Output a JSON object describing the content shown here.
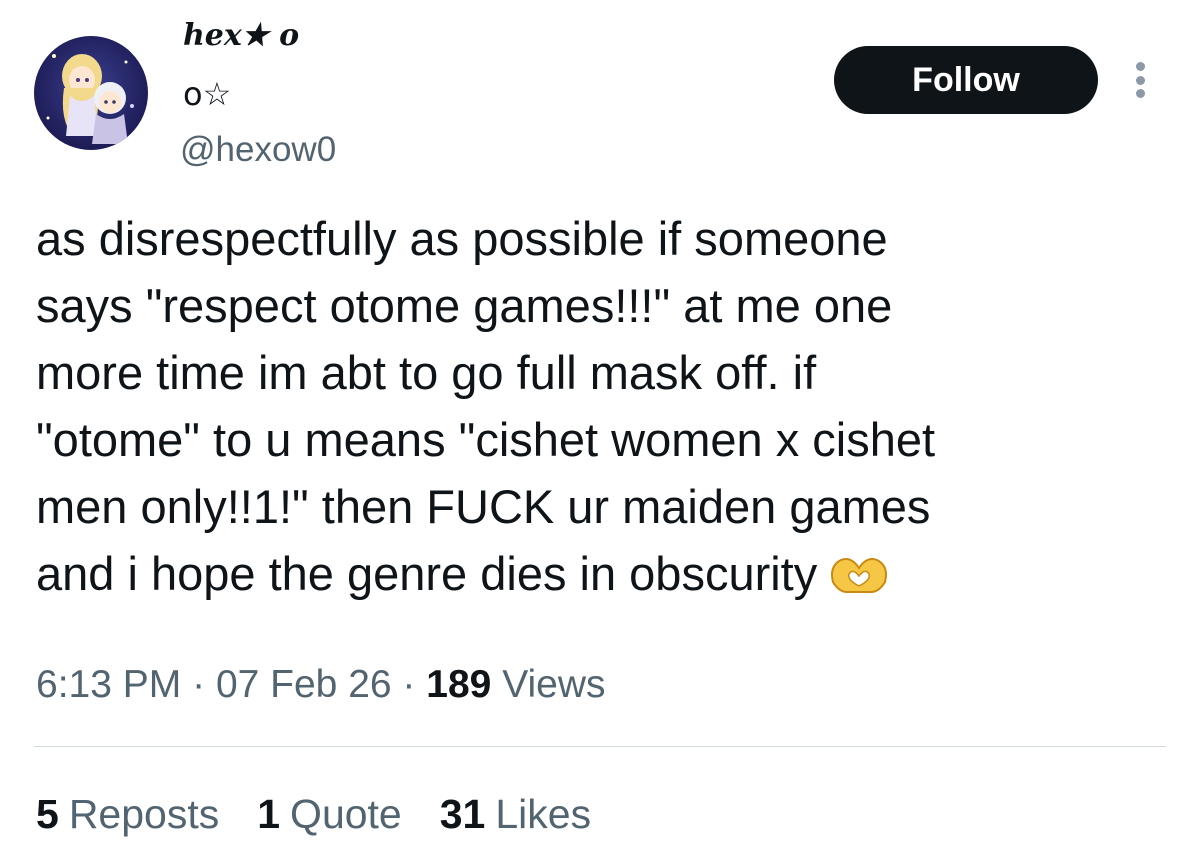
{
  "tweet": {
    "author": {
      "display_name_line1": "hex★ ο",
      "display_name_line2": "ο☆",
      "handle": "@hexow0",
      "avatar_icon": "anime-avatar-icon"
    },
    "follow_label": "Follow",
    "more_icon": "more-vertical-icon",
    "text": "as disrespectfully as possible if someone\nsays \"respect otome games!!!\" at me one\nmore time im abt to go full mask off. if\n\"otome\" to u means \"cishet women x cishet\nmen only!!1!\" then FUCK ur maiden games\nand i hope the genre dies in obscurity",
    "emoji": "heart-hands-emoji",
    "time": "6:13 PM",
    "date": "07 Feb 26",
    "separator": "·",
    "views_count": "189",
    "views_label": "Views",
    "stats": {
      "reposts_count": "5",
      "reposts_label": "Reposts",
      "quotes_count": "1",
      "quotes_label": "Quote",
      "likes_count": "31",
      "likes_label": "Likes"
    }
  },
  "colors": {
    "text_primary": "#0f1419",
    "text_secondary": "#536471",
    "follow_bg": "#0f1419",
    "divider": "#cfd9de"
  }
}
